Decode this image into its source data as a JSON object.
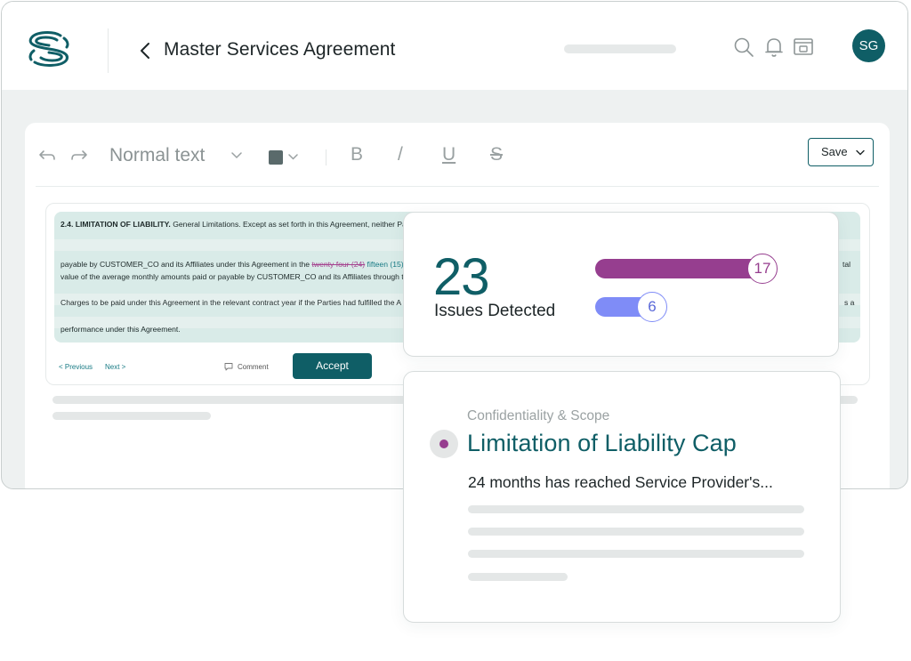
{
  "header": {
    "title": "Master Services Agreement",
    "avatar_initials": "SG"
  },
  "toolbar": {
    "text_style": "Normal text",
    "bold": "B",
    "italic": "/",
    "underline": "U",
    "strikethrough": "S",
    "save_label": "Save"
  },
  "clause": {
    "heading": "2.4. LIMITATION OF LIABILITY.",
    "line1_rest": " General Limitations. Except as set forth in this Agreement, neither Part",
    "line2_pre": "payable by CUSTOMER_CO and its Affiliates under this Agreement in the ",
    "line2_strike": "twenty four (24)",
    "line2_insert": " fifteen (15)",
    "line2_post": " n",
    "line2_tail": "tal",
    "line3": "value of the average monthly amounts paid or payable by CUSTOMER_CO and its Affiliates through th",
    "line4": "Charges to be paid under this Agreement in the relevant contract year if the Parties had fulfilled the A",
    "line4_tail": "s a",
    "line5": "performance under this Agreement.",
    "prev_label": "< Previous",
    "next_label": "Next >",
    "comment_label": "Comment",
    "accept_label": "Accept"
  },
  "summary": {
    "issues_count": "23",
    "issues_label": "Issues Detected",
    "bars": [
      {
        "value": 17,
        "color": "#963e8f"
      },
      {
        "value": 6,
        "color": "#7f8cf7"
      }
    ]
  },
  "issue": {
    "category": "Confidentiality & Scope",
    "title": "Limitation of Liability Cap",
    "description": "24 months has reached Service Provider's..."
  },
  "colors": {
    "brand": "#0f5e66",
    "accent_purple": "#963e8f",
    "accent_blue": "#7f8cf7",
    "highlight": "#d9ebe8"
  },
  "icons": [
    "logo-icon",
    "back-chevron-icon",
    "search-icon",
    "bell-icon",
    "share-screen-icon",
    "undo-icon",
    "redo-icon",
    "chevron-down-icon",
    "comment-icon"
  ]
}
